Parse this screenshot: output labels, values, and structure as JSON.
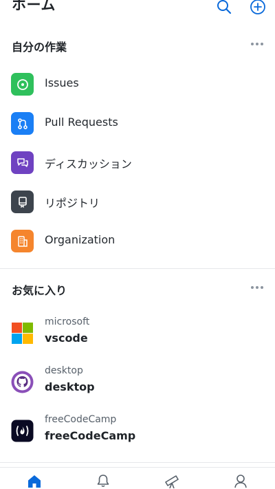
{
  "header": {
    "title": "ホーム"
  },
  "colors": {
    "accent": "#0969da",
    "issues": "#2fc05c",
    "pull_requests": "#1a7ff5",
    "discussions": "#6f42c1",
    "repositories": "#3d444d",
    "organization": "#f5852d"
  },
  "my_work": {
    "title": "自分の作業",
    "items": [
      {
        "label": "Issues",
        "icon": "issue-opened-icon"
      },
      {
        "label": "Pull Requests",
        "icon": "git-pull-request-icon"
      },
      {
        "label": "ディスカッション",
        "icon": "comment-discussion-icon"
      },
      {
        "label": "リポジトリ",
        "icon": "repo-icon"
      },
      {
        "label": "Organization",
        "icon": "organization-icon"
      }
    ]
  },
  "favorites": {
    "title": "お気に入り",
    "items": [
      {
        "owner": "microsoft",
        "name": "vscode",
        "icon": "microsoft-logo-icon"
      },
      {
        "owner": "desktop",
        "name": "desktop",
        "icon": "github-desktop-logo-icon"
      },
      {
        "owner": "freeCodeCamp",
        "name": "freeCodeCamp",
        "icon": "freecodecamp-logo-icon"
      }
    ]
  },
  "tabbar": {
    "tabs": [
      {
        "name": "home",
        "icon": "home-icon",
        "selected": true
      },
      {
        "name": "notifications",
        "icon": "bell-icon",
        "selected": false
      },
      {
        "name": "explore",
        "icon": "telescope-icon",
        "selected": false
      },
      {
        "name": "profile",
        "icon": "person-icon",
        "selected": false
      }
    ]
  }
}
